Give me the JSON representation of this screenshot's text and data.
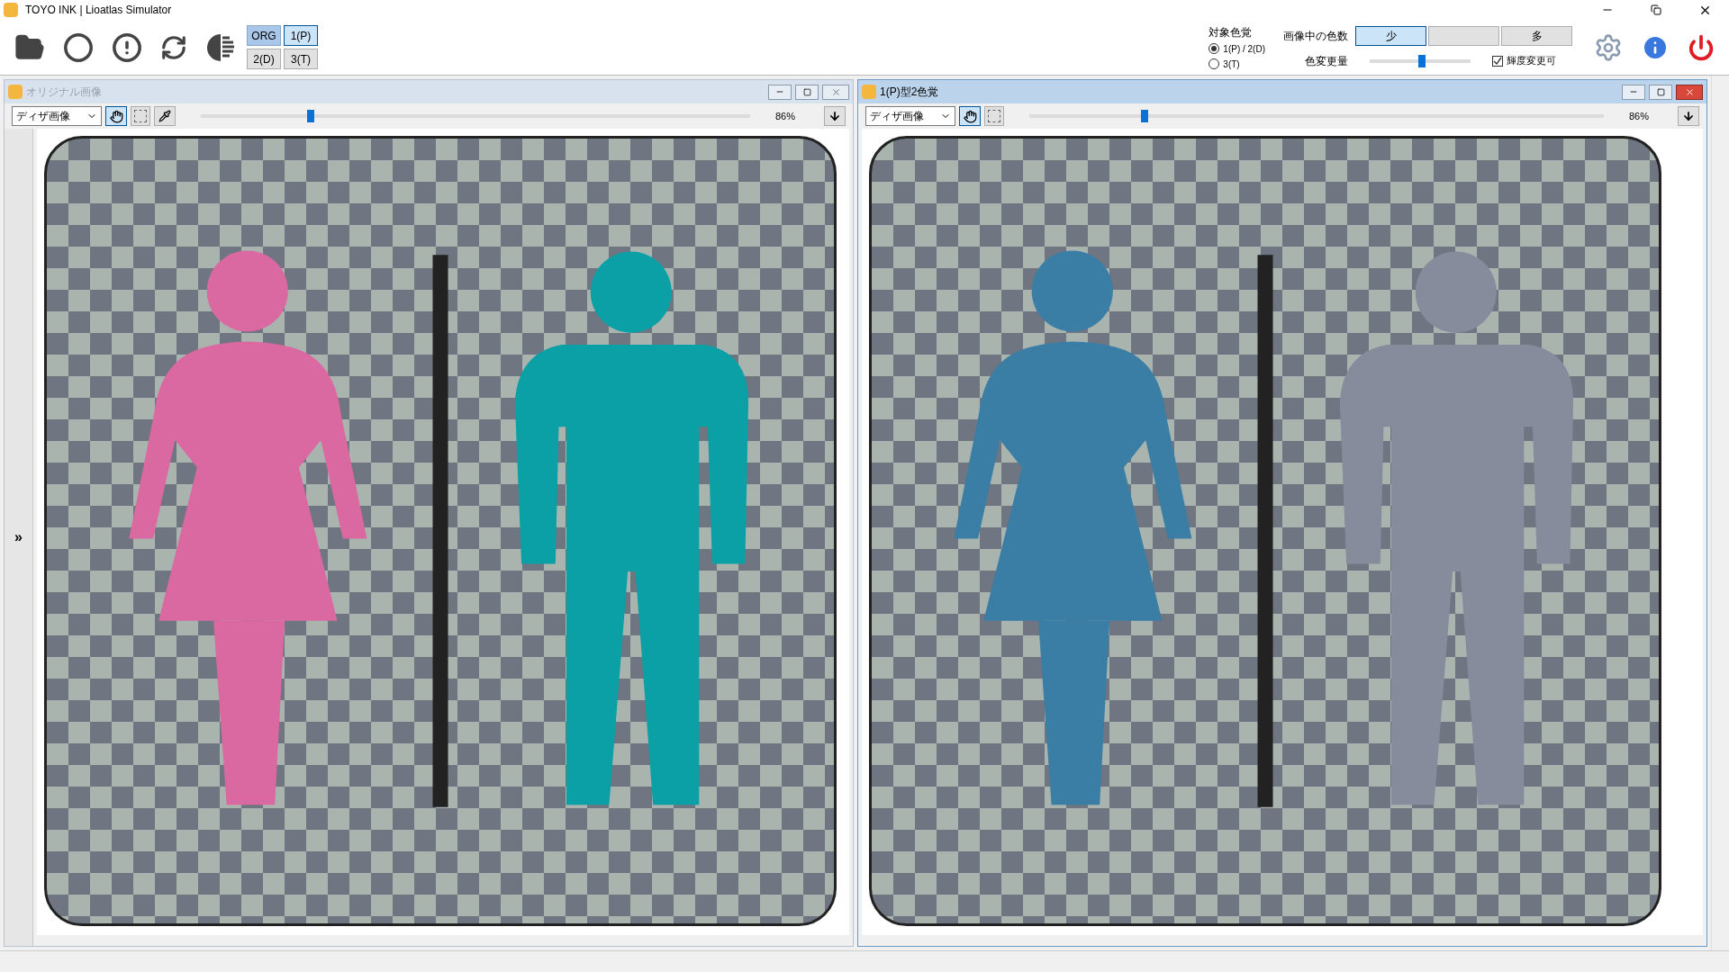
{
  "window": {
    "title": "TOYO INK | Lioatlas Simulator"
  },
  "mode_buttons": [
    {
      "label": "ORG",
      "pressed": true,
      "focused": false
    },
    {
      "label": "1(P)",
      "pressed": false,
      "focused": true
    },
    {
      "label": "2(D)",
      "pressed": false,
      "focused": false
    },
    {
      "label": "3(T)",
      "pressed": false,
      "focused": false
    }
  ],
  "vision_target": {
    "label": "対象色覚",
    "options": [
      {
        "label": "1(P) / 2(D)",
        "selected": true
      },
      {
        "label": "3(T)",
        "selected": false
      }
    ]
  },
  "color_count": {
    "label": "画像中の色数",
    "buttons": [
      {
        "label": "少",
        "selected": true
      },
      {
        "selected": false
      },
      {
        "label": "多",
        "selected": false
      }
    ]
  },
  "color_change": {
    "label": "色変更量",
    "level": 0.52
  },
  "brightness_checkbox": {
    "label": "輝度変更可",
    "checked": true
  },
  "panels": [
    {
      "title": "オリジナル画像",
      "active": false,
      "view_mode": "ディザ画像",
      "side_toggle": "»",
      "eyedropper": true,
      "zoom": {
        "level": 0.2,
        "reading": "86%"
      },
      "figures": [
        {
          "kind": "woman",
          "color": "#da69a1"
        },
        {
          "kind": "bar",
          "color": "#222222"
        },
        {
          "kind": "man",
          "color": "#0b9fa6"
        }
      ]
    },
    {
      "title": "1(P)型2色覚",
      "active": true,
      "view_mode": "ディザ画像",
      "eyedropper": false,
      "zoom": {
        "level": 0.2,
        "reading": "86%"
      },
      "figures": [
        {
          "kind": "woman",
          "color": "#3a7ea5"
        },
        {
          "kind": "bar",
          "color": "#222222"
        },
        {
          "kind": "man",
          "color": "#878c9c"
        }
      ]
    }
  ]
}
